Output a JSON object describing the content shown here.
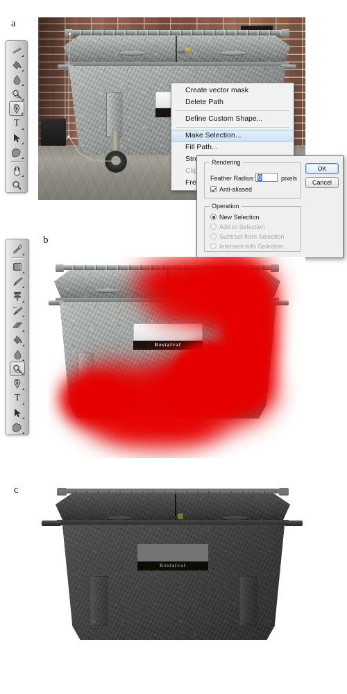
{
  "figure": {
    "panels": [
      {
        "letter": "a",
        "caption": ""
      },
      {
        "letter": "b",
        "caption": ""
      },
      {
        "letter": "c",
        "caption": ""
      }
    ]
  },
  "photo": {
    "sign_text": "Restafval",
    "subject": "waste-container"
  },
  "toolbar_a": {
    "tools": [
      {
        "name": "gradient-tool",
        "glyph": "gradient",
        "selected": false,
        "has_flyout": true
      },
      {
        "name": "paint-bucket-tool",
        "glyph": "bucket",
        "selected": false,
        "has_flyout": true
      },
      {
        "name": "blur-tool",
        "glyph": "droplet",
        "selected": false,
        "has_flyout": true
      },
      {
        "name": "dodge-tool",
        "glyph": "dodge",
        "selected": false,
        "has_flyout": true
      },
      {
        "name": "pen-tool",
        "glyph": "pen",
        "selected": true,
        "has_flyout": true
      },
      {
        "name": "horizontal-type-tool",
        "glyph": "type",
        "selected": false,
        "has_flyout": true
      },
      {
        "name": "path-selection-tool",
        "glyph": "arrow",
        "selected": false,
        "has_flyout": true
      },
      {
        "name": "custom-shape-tool",
        "glyph": "shape",
        "selected": false,
        "has_flyout": true
      },
      {
        "name": "hand-tool",
        "glyph": "hand",
        "selected": false,
        "has_flyout": true
      },
      {
        "name": "zoom-tool",
        "glyph": "magnifier",
        "selected": false,
        "has_flyout": false
      }
    ],
    "divider_after_index": 7
  },
  "toolbar_b": {
    "tools": [
      {
        "name": "eyedropper-tool",
        "glyph": "eyedropper",
        "selected": false,
        "has_flyout": true
      },
      {
        "name": "patch-tool",
        "glyph": "patch",
        "selected": false,
        "has_flyout": true
      },
      {
        "name": "brush-tool",
        "glyph": "brush",
        "selected": false,
        "has_flyout": true
      },
      {
        "name": "clone-stamp-tool",
        "glyph": "stamp",
        "selected": false,
        "has_flyout": true
      },
      {
        "name": "history-brush-tool",
        "glyph": "history",
        "selected": false,
        "has_flyout": true
      },
      {
        "name": "eraser-tool",
        "glyph": "eraser",
        "selected": false,
        "has_flyout": true
      },
      {
        "name": "paint-bucket-tool",
        "glyph": "bucket",
        "selected": false,
        "has_flyout": true
      },
      {
        "name": "blur-tool",
        "glyph": "droplet",
        "selected": false,
        "has_flyout": true
      },
      {
        "name": "dodge-tool",
        "glyph": "dodge",
        "selected": true,
        "has_flyout": true
      },
      {
        "name": "pen-tool",
        "glyph": "pen",
        "selected": false,
        "has_flyout": true
      },
      {
        "name": "horizontal-type-tool",
        "glyph": "type",
        "selected": false,
        "has_flyout": true
      },
      {
        "name": "path-selection-tool",
        "glyph": "arrow",
        "selected": false,
        "has_flyout": true
      },
      {
        "name": "custom-shape-tool",
        "glyph": "shape",
        "selected": false,
        "has_flyout": true
      }
    ],
    "divider_after_index": 0
  },
  "context_menu": {
    "items": [
      {
        "label": "Create vector mask",
        "highlighted": false,
        "disabled": false,
        "separator_after": false
      },
      {
        "label": "Delete Path",
        "highlighted": false,
        "disabled": false,
        "separator_after": true
      },
      {
        "label": "Define Custom Shape...",
        "highlighted": false,
        "disabled": false,
        "separator_after": true
      },
      {
        "label": "Make Selection...",
        "highlighted": true,
        "disabled": false,
        "separator_after": false
      },
      {
        "label": "Fill Path...",
        "highlighted": false,
        "disabled": false,
        "separator_after": false
      },
      {
        "label": "Stroke Path...",
        "highlighted": false,
        "disabled": false,
        "separator_after": false
      },
      {
        "label": "Clipping Path...",
        "highlighted": false,
        "disabled": true,
        "separator_after": false
      },
      {
        "label": "Free Transform Path",
        "highlighted": false,
        "disabled": false,
        "separator_after": false
      }
    ]
  },
  "dialog": {
    "rendering": {
      "legend": "Rendering",
      "feather_radius_label": "Feather Radius:",
      "feather_radius_value": "0",
      "feather_radius_units": "pixels",
      "anti_aliased_label": "Anti-aliased",
      "anti_aliased_checked": true
    },
    "operation": {
      "legend": "Operation",
      "options": [
        {
          "label": "New Selection",
          "selected": true,
          "disabled": false
        },
        {
          "label": "Add to Selection",
          "selected": false,
          "disabled": true
        },
        {
          "label": "Subtract from Selection",
          "selected": false,
          "disabled": true
        },
        {
          "label": "Intersect with Selection",
          "selected": false,
          "disabled": true
        }
      ]
    },
    "buttons": {
      "ok": "OK",
      "cancel": "Cancel"
    }
  },
  "colors": {
    "mask_red": "#e60000",
    "highlight_blue": "#cfe3f4",
    "selection_blue": "#3b7fd4",
    "brick": "#8c5a47",
    "galvanized": "#9ea3a1",
    "page_background": "#ffffff"
  }
}
